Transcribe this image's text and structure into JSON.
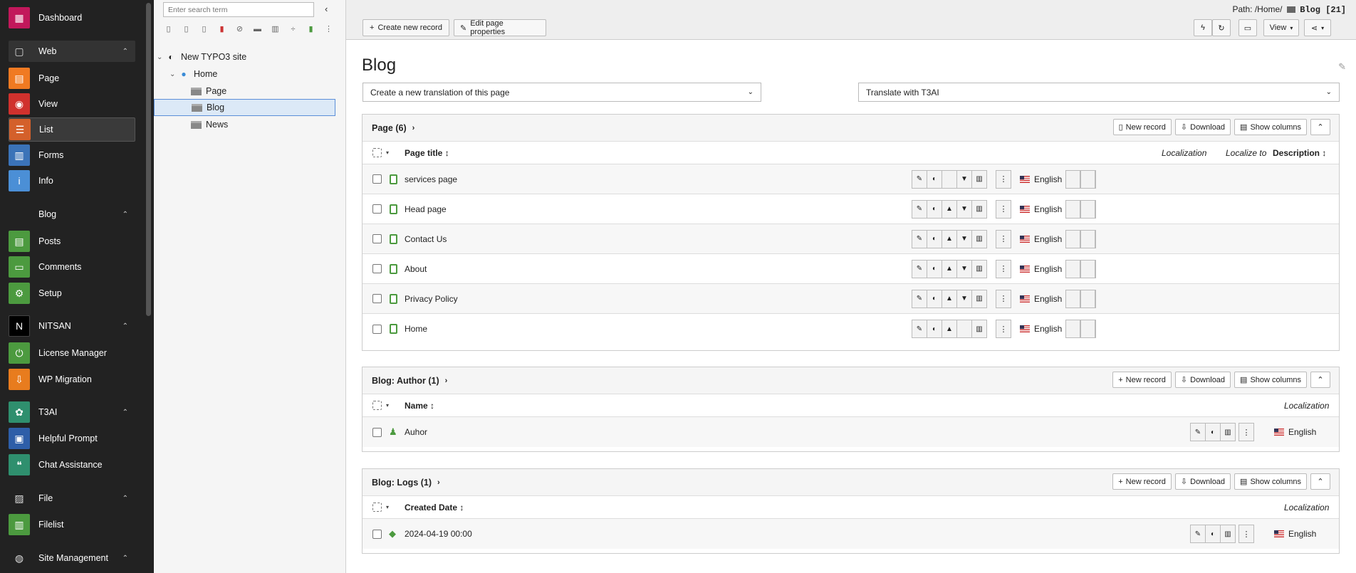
{
  "sidebar": {
    "dashboard": "Dashboard",
    "groups": {
      "web": "Web",
      "blog": "Blog",
      "nitsan": "NITSAN",
      "t3ai": "T3AI",
      "file": "File",
      "site": "Site Management"
    },
    "items": {
      "page": "Page",
      "view": "View",
      "list": "List",
      "forms": "Forms",
      "info": "Info",
      "posts": "Posts",
      "comments": "Comments",
      "setup": "Setup",
      "license": "License Manager",
      "wp": "WP Migration",
      "prompt": "Helpful Prompt",
      "chat": "Chat Assistance",
      "filelist": "Filelist"
    }
  },
  "tree": {
    "search_placeholder": "Enter search term",
    "root": "New TYPO3 site",
    "home": "Home",
    "children": [
      "Page",
      "Blog",
      "News"
    ]
  },
  "header": {
    "path_label": "Path: /Home/",
    "path_page": "Blog [21]",
    "create_record": "Create new record",
    "edit_props": "Edit page properties",
    "view": "View"
  },
  "content": {
    "title": "Blog",
    "translation_select": "Create a new translation of this page",
    "translate_select": "Translate with T3AI"
  },
  "common": {
    "new_record": "New record",
    "download": "Download",
    "show_columns": "Show columns",
    "localization": "Localization",
    "localize_to": "Localize to",
    "english": "English"
  },
  "pages_table": {
    "title": "Page (6)",
    "col_title": "Page title",
    "col_description": "Description",
    "rows": [
      "services page",
      "Head page",
      "Contact Us",
      "About",
      "Privacy Policy",
      "Home"
    ]
  },
  "author_table": {
    "title": "Blog: Author (1)",
    "col_name": "Name",
    "rows": [
      "Auhor"
    ]
  },
  "logs_table": {
    "title": "Blog: Logs (1)",
    "col_date": "Created Date",
    "rows": [
      "2024-04-19 00:00"
    ]
  },
  "colors": {
    "sidebar_bg": "#222222",
    "page_icon": "#4c9a3f",
    "selection": "#dce9f7"
  }
}
